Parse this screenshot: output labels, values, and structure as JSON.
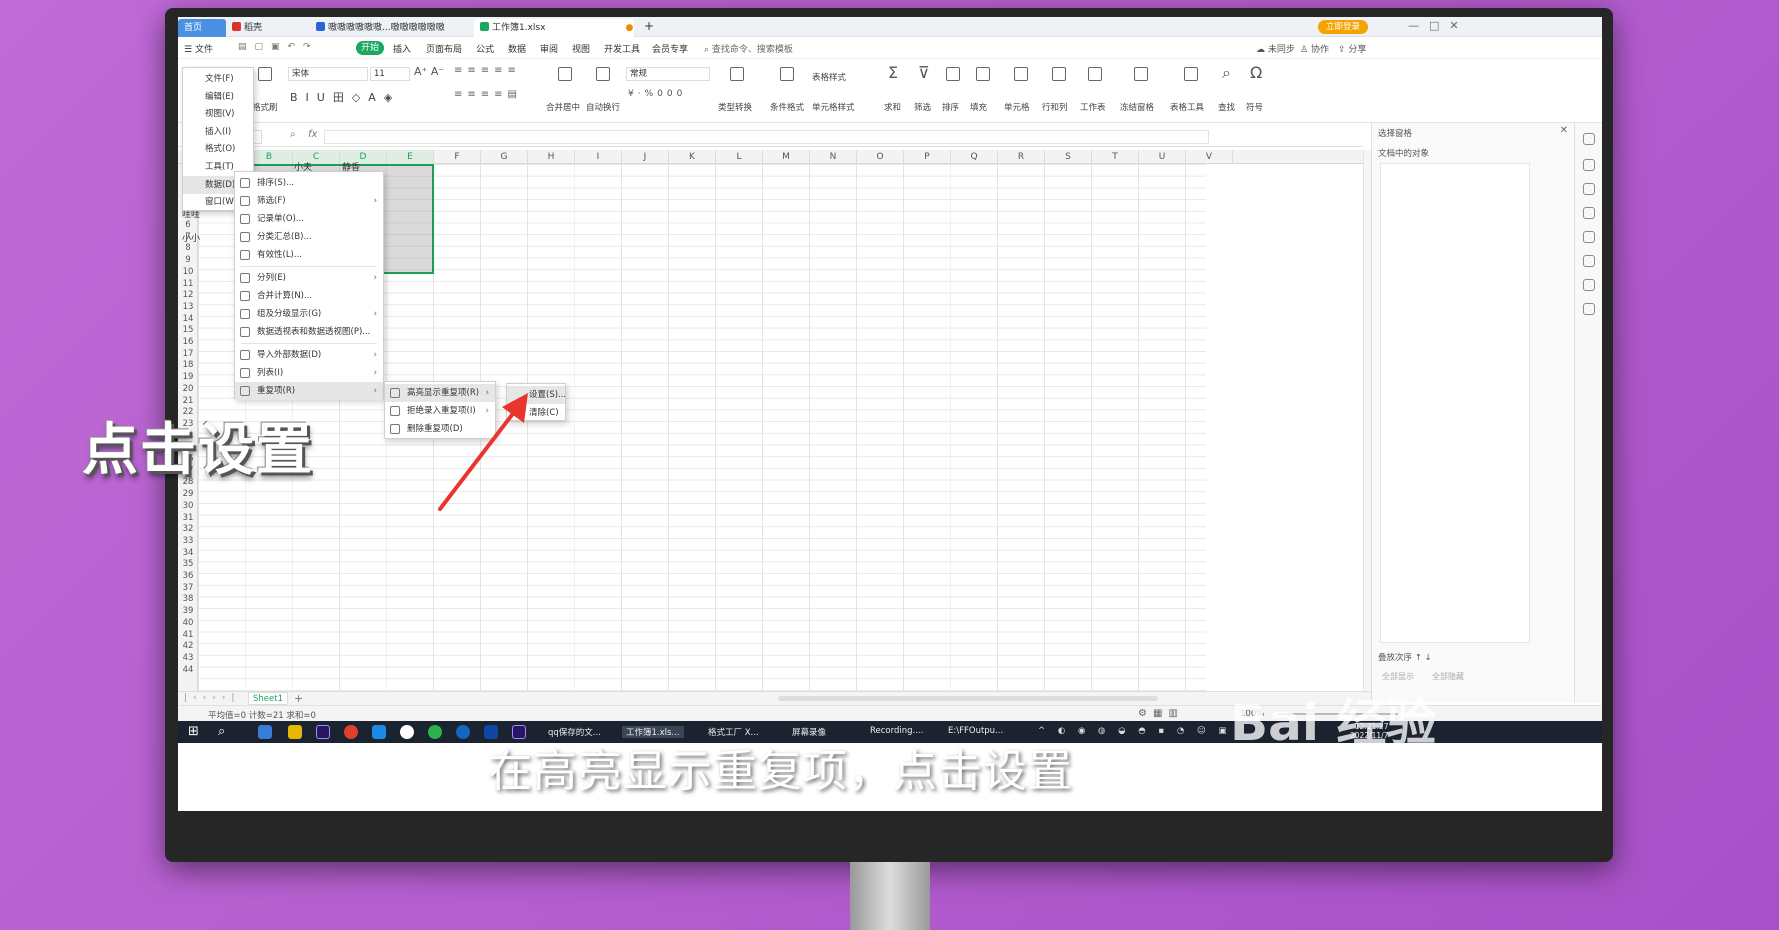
{
  "tabs": [
    {
      "label": "首页",
      "color": "#4a90e2"
    },
    {
      "label": "稻壳",
      "color": "#d9342b"
    },
    {
      "label": "嗷嗷嗷嗷嗷嗷...嗷嗷嗷嗷嗷嗷",
      "color": "#2b64d9"
    },
    {
      "label": "工作簿1.xlsx",
      "color": "#1aa760"
    }
  ],
  "top_right": {
    "login": "立即登录"
  },
  "menubar": {
    "file": "文件",
    "start": "开始",
    "items": [
      "插入",
      "页面布局",
      "公式",
      "数据",
      "审阅",
      "视图",
      "开发工具",
      "会员专享"
    ],
    "search": "查找命令、搜索模板",
    "sync": "未同步",
    "collab": "协作",
    "share": "分享"
  },
  "ribbon": {
    "font": "宋体",
    "size": "11",
    "numfmt": "常规",
    "labels": [
      "格式刷",
      "合并居中",
      "自动换行",
      "类型转换",
      "条件格式",
      "表格样式",
      "单元格样式",
      "求和",
      "筛选",
      "排序",
      "填充",
      "单元格",
      "行和列",
      "工作表",
      "冻结窗格",
      "表格工具",
      "查找",
      "符号"
    ]
  },
  "formula": {
    "fx": "fx"
  },
  "columns": [
    "B",
    "C",
    "D",
    "E",
    "F",
    "G",
    "H",
    "I",
    "J",
    "K",
    "L",
    "M",
    "N",
    "O",
    "P",
    "Q",
    "R",
    "S",
    "T",
    "U",
    "V"
  ],
  "rows": [
    "6",
    "7",
    "8",
    "9",
    "10",
    "11",
    "12",
    "13",
    "14",
    "15",
    "16",
    "17",
    "18",
    "19",
    "20",
    "21",
    "22",
    "23",
    "24",
    "25",
    "26",
    "27",
    "28",
    "29",
    "30",
    "31",
    "32",
    "33",
    "34",
    "35",
    "36",
    "37",
    "38",
    "39",
    "40",
    "41",
    "42",
    "43",
    "44"
  ],
  "cells": {
    "c1": "小夫",
    "c2": "静香",
    "c3": "哇哇",
    "c4": "小小"
  },
  "left_menu": [
    {
      "label": "文件(F)"
    },
    {
      "label": "编辑(E)"
    },
    {
      "label": "视图(V)"
    },
    {
      "label": "插入(I)"
    },
    {
      "label": "格式(O)"
    },
    {
      "label": "工具(T)"
    },
    {
      "label": "数据(D)"
    },
    {
      "label": "窗口(W)"
    }
  ],
  "data_menu": [
    {
      "label": "排序(S)..."
    },
    {
      "label": "筛选(F)",
      "arrow": "›"
    },
    {
      "label": "记录单(O)..."
    },
    {
      "label": "分类汇总(B)..."
    },
    {
      "label": "有效性(L)..."
    },
    {
      "label": "分列(E)",
      "arrow": "›"
    },
    {
      "label": "合并计算(N)..."
    },
    {
      "label": "组及分级显示(G)",
      "arrow": "›"
    },
    {
      "label": "数据透视表和数据透视图(P)..."
    },
    {
      "label": "导入外部数据(D)",
      "arrow": "›"
    },
    {
      "label": "列表(I)",
      "arrow": "›"
    },
    {
      "label": "重复项(R)",
      "arrow": "›"
    }
  ],
  "dup_menu": [
    {
      "label": "高亮显示重复项(R)",
      "arrow": "›"
    },
    {
      "label": "拒绝录入重复项(I)",
      "arrow": "›"
    },
    {
      "label": "删除重复项(D)"
    }
  ],
  "setting_menu": [
    {
      "label": "设置(S)..."
    },
    {
      "label": "清除(C)"
    }
  ],
  "pane": {
    "title": "选择窗格",
    "objects": "文档中的对象",
    "order": "叠放次序",
    "show_all": "全部显示",
    "hide_all": "全部隐藏"
  },
  "sheet": {
    "name": "Sheet1"
  },
  "status": {
    "stats": "平均值=0 计数=21 求和=0",
    "zoom": "100%"
  },
  "taskbar": [
    "qq保存的文...",
    "工作簿1.xls...",
    "格式工厂 X...",
    "屏幕录像",
    "Recording....",
    "E:\\FFOutpu..."
  ],
  "taskbar_time": "12:21:27",
  "taskbar_date": "2022/11/7",
  "overlay": "点击设置",
  "subtitle": "在高亮显示重复项，点击设置",
  "watermark": {
    "brand": "Bai 经验",
    "url": "jingyan.baidu.com"
  },
  "accent": "#1f9d55"
}
